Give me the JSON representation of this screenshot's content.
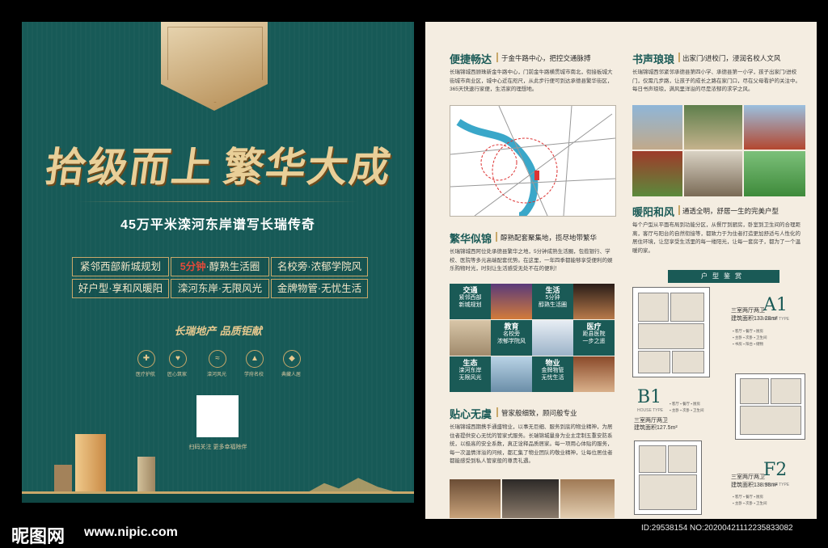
{
  "left": {
    "headline_a": "拾级而上",
    "headline_b": "繁华大成",
    "subtitle": "45万平米滦河东岸谱写长瑞传奇",
    "tags": [
      {
        "hl": "",
        "text": "紧邻西部新城规划"
      },
      {
        "hl": "5分钟",
        "text": "·醇熟生活圈"
      },
      {
        "hl": "",
        "text": "名校旁·浓郁学院风"
      },
      {
        "hl": "",
        "text": "好户型·享和风暖阳"
      },
      {
        "hl": "",
        "text": "滦河东岸·无限风光"
      },
      {
        "hl": "",
        "text": "金牌物管·无忧生活"
      }
    ],
    "slogan": "长瑞地产 品质钜献",
    "icons": [
      {
        "glyph": "✚",
        "label": "医疗护航"
      },
      {
        "glyph": "♥",
        "label": "匠心筑家"
      },
      {
        "glyph": "≈",
        "label": "滦河风光"
      },
      {
        "glyph": "▲",
        "label": "学府名校"
      },
      {
        "glyph": "◆",
        "label": "典藏人居"
      }
    ],
    "qr_caption": "扫码关注 更多幸福除伴",
    "colors": {
      "panel": "#175a57",
      "gold": "#c9a86a"
    }
  },
  "right": {
    "s1": {
      "title": "便捷畅达",
      "sub": "于金牛路中心，把控交通脉搏",
      "body": "长瑞锦城西顾珠新金牛路中心，门前金牛路横贯城市南北，衔接板城大街城市商业区，城中心近在咫尺，从此步行便可到达承德县繁华街区，365天快速行家便，生活家的理想地。"
    },
    "s2": {
      "title": "书声琅琅",
      "sub": "出家门/进校门，浸润名校人文风",
      "body": "长瑞锦城西邻紧邻承德县第四小学、承德县第一小学，孩子出家门/进校门，仅需几步路，让孩子的成长之路在家门口，尽在父母看护的关注中。每日书声琅琅，满风里洋溢的尽是浓郁的求学之风。"
    },
    "s3": {
      "title": "繁华似锦",
      "sub": "醇熟配套聚集地，揽尽地带繁华",
      "body": "长瑞锦城西阿位处承德县繁华之地，5分钟成熟生活圈，包揽银行、学校、医院等多元高端配套优势。在这里，一年四季都能够享受便利的娱乐购物时光，时刻让生活感受无处不在的便利！"
    },
    "s4": {
      "title": "暖阳和风",
      "sub": "通透全明，舒居一生的完美户型",
      "body": "每个户型从平面布局到功能分区，从餐厅到厨房，卧室到卫生间的合理距离，客厅与阳台的自然衔接等，都致力于为住者打造更加舒适与人性化的居住环境，让您享受生活里的每一缕阳光，让每一套房子，都为了一个温暖的家。"
    },
    "s5": {
      "title": "贴心无虞",
      "sub": "管家般细致，顾问般专业",
      "body": "长瑞锦城西期携手通盛物业，以事无巨细、服务到底的物业精神，为居住者提供安心无忧的管家式服务。长瑞锦城量身为业主定制五重安防系统，以极高的安全系数，真正诠释品质居家。每一项用心体贴的服务，每一次温情洋溢的问候，都汇集了物业团队的敬业精神，让每位居住者都能感受到私人管家般的尊贵礼遇。"
    },
    "grid": [
      {
        "title": "交通",
        "line1": "紧邻西部",
        "line2": "新城规划"
      },
      {
        "title": "生活",
        "line1": "5分钟",
        "line2": "醇熟生活圈"
      },
      {
        "title": "教育",
        "line1": "名校旁",
        "line2": "浓郁学院风"
      },
      {
        "title": "医疗",
        "line1": "距县医院",
        "line2": "一步之遥"
      },
      {
        "title": "生态",
        "line1": "滦河东岸",
        "line2": "无限风光"
      },
      {
        "title": "物业",
        "line1": "金牌物管",
        "line2": "无忧生活"
      }
    ],
    "huxing": "户型鉴赏",
    "types": [
      {
        "letter": "A1",
        "desc": "三室两厅两卫",
        "area": "建筑面积133.28m²",
        "sub": "HOUSE TYPE"
      },
      {
        "letter": "B1",
        "desc": "三室两厅两卫",
        "area": "建筑面积127.5m²",
        "sub": "HOUSE TYPE"
      },
      {
        "letter": "F2",
        "desc": "三室两厅两卫",
        "area": "建筑面积138.98m²",
        "sub": "HOUSE TYPE"
      }
    ],
    "colors": {
      "teal": "#1a5a56",
      "bg": "#f4ede1"
    }
  },
  "watermark": {
    "brand": "昵图网",
    "url": "www.nipic.com",
    "id": "ID:29538154 NO:20200421112235833082"
  }
}
